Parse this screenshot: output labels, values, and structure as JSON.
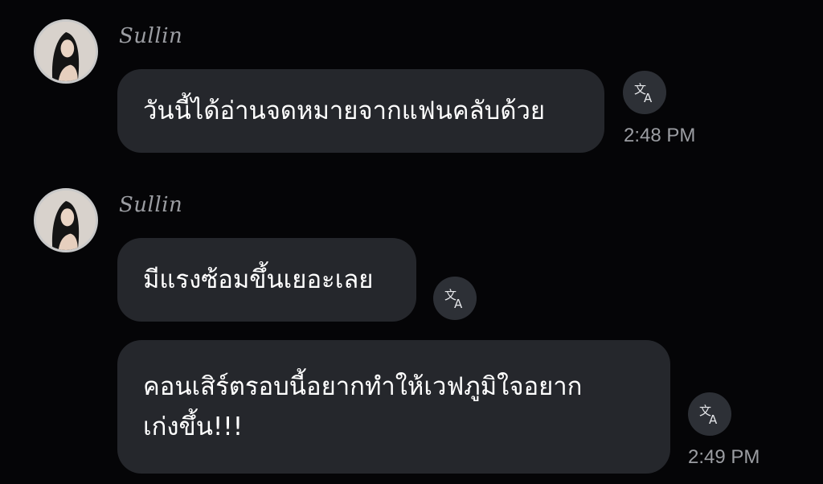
{
  "messages": [
    {
      "sender": "Sullin",
      "text": "วันนี้ได้อ่านจดหมายจากแฟนคลับด้วย",
      "time": "2:48 PM"
    },
    {
      "sender": "Sullin",
      "text": "มีแรงซ้อมขึ้นเยอะเลย"
    },
    {
      "text_line1": "คอนเสิร์ตรอบนี้อยากทำให้เวฟภูมิใจอยาก",
      "text_line2": "เก่งขึ้น!!!",
      "time": "2:49 PM"
    }
  ],
  "icons": {
    "translate": "translate-icon",
    "avatar": "avatar"
  },
  "colors": {
    "background": "#050507",
    "bubble": "#25272c",
    "muted": "#9b9da2"
  }
}
